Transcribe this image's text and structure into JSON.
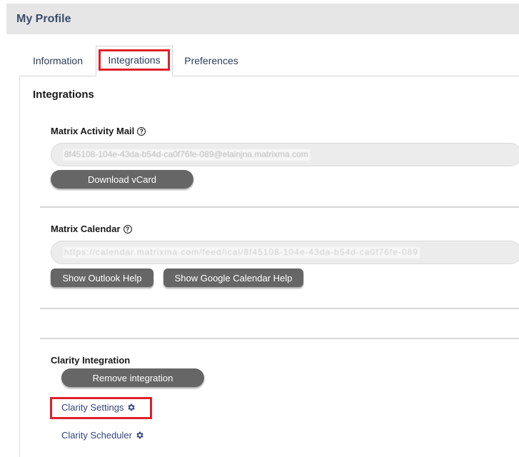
{
  "header": {
    "title": "My Profile"
  },
  "tabs": [
    {
      "label": "Information"
    },
    {
      "label": "Integrations"
    },
    {
      "label": "Preferences"
    }
  ],
  "main": {
    "heading": "Integrations",
    "activity_mail": {
      "label": "Matrix Activity Mail",
      "help_icon": "question-circle-icon",
      "value": "8f45108-104e-43da-b54d-ca0f76fe-089@elainjna.matrixma.com",
      "download_button": "Download vCard"
    },
    "calendar": {
      "label": "Matrix Calendar",
      "help_icon": "question-circle-icon",
      "value": "https://calendar.matrixma.com/feed/ical/8f45108-104e-43da-b54d-ca0f76fe-089",
      "outlook_button": "Show Outlook Help",
      "google_button": "Show Google Calendar Help"
    },
    "clarity": {
      "label": "Clarity Integration",
      "remove_button": "Remove integration",
      "settings_link": "Clarity Settings",
      "scheduler_link": "Clarity Scheduler",
      "link_icon": "gear-icon"
    }
  },
  "colors": {
    "header_bg": "#e6e6e6",
    "title_text": "#3a4c6b",
    "button_bg": "#666666",
    "highlight": "#e0202a",
    "link": "#34457a"
  }
}
